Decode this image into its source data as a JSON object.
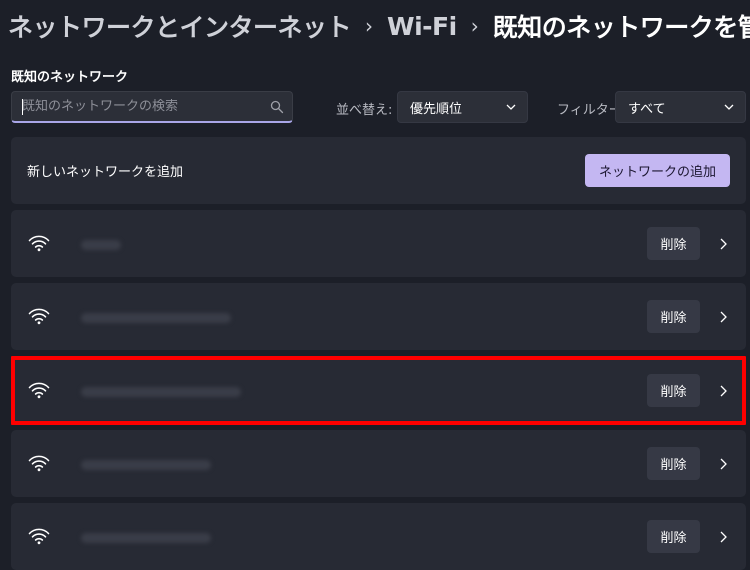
{
  "breadcrumb": {
    "items": [
      "ネットワークとインターネット",
      "Wi-Fi",
      "既知のネットワークを管理"
    ]
  },
  "known_networks": {
    "section_label": "既知のネットワーク",
    "search_placeholder": "既知のネットワークの検索",
    "sort_label": "並べ替え:",
    "sort_value": "優先順位",
    "filter_label": "フィルター:",
    "filter_value": "すべて"
  },
  "add_network": {
    "label": "新しいネットワークを追加",
    "button": "ネットワークの追加"
  },
  "networks": [
    {
      "name": "",
      "delete_label": "削除"
    },
    {
      "name": "",
      "delete_label": "削除"
    },
    {
      "name": "",
      "delete_label": "削除"
    },
    {
      "name": "",
      "delete_label": "削除"
    },
    {
      "name": "",
      "delete_label": "削除"
    }
  ],
  "colors": {
    "background": "#1c1f28",
    "card": "#272a34",
    "accent_button": "#c4b7f2",
    "highlight": "#ff0000"
  },
  "icons": [
    "search-icon",
    "chevron-down-icon",
    "wifi-icon",
    "chevron-right-icon"
  ]
}
